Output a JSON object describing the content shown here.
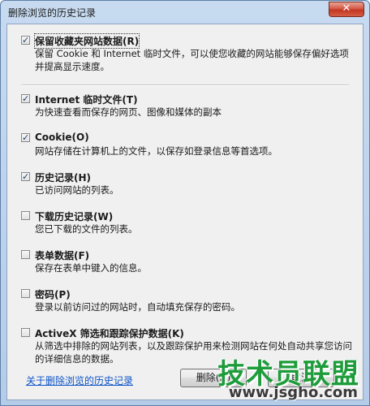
{
  "window": {
    "title": "删除浏览的历史记录",
    "close_symbol": "✕"
  },
  "options": [
    {
      "id": "favorites",
      "label": "保留收藏夹网站数据(R)",
      "description": "保留 Cookie 和 Internet 临时文件，可以使您收藏的网站能够保存偏好选项并提高显示速度。",
      "checked": true,
      "check_glyph": "✓"
    },
    {
      "id": "temp-files",
      "label": "Internet 临时文件(T)",
      "description": "为快速查看而保存的网页、图像和媒体的副本",
      "checked": true,
      "check_glyph": "✓"
    },
    {
      "id": "cookies",
      "label": "Cookie(O)",
      "description": "网站存储在计算机上的文件，以保存如登录信息等首选项。",
      "checked": true,
      "check_glyph": "✓"
    },
    {
      "id": "history",
      "label": "历史记录(H)",
      "description": "已访问网站的列表。",
      "checked": true,
      "check_glyph": "✓"
    },
    {
      "id": "download-history",
      "label": "下载历史记录(W)",
      "description": "您已下载的文件的列表。",
      "checked": false,
      "check_glyph": ""
    },
    {
      "id": "form-data",
      "label": "表单数据(F)",
      "description": "保存在表单中键入的信息。",
      "checked": false,
      "check_glyph": ""
    },
    {
      "id": "passwords",
      "label": "密码(P)",
      "description": "登录以前访问过的网站时，自动填充保存的密码。",
      "checked": false,
      "check_glyph": ""
    },
    {
      "id": "activex",
      "label": "ActiveX 筛选和跟踪保护数据(K)",
      "description": "从筛选中排除的网站列表，以及跟踪保护用来检测网站在何处自动共享您访问的详细信息的数据。",
      "checked": false,
      "check_glyph": ""
    }
  ],
  "footer": {
    "help_link": "关于删除浏览的历史记录",
    "delete_button": "删除(D)",
    "cancel_button": "取消"
  },
  "watermark": {
    "main": "技术员联盟",
    "url": "www.jsgho.com"
  },
  "colors": {
    "link": "#0f55c8",
    "check": "#1f3f73",
    "watermark_green": "#1e9c3b"
  }
}
